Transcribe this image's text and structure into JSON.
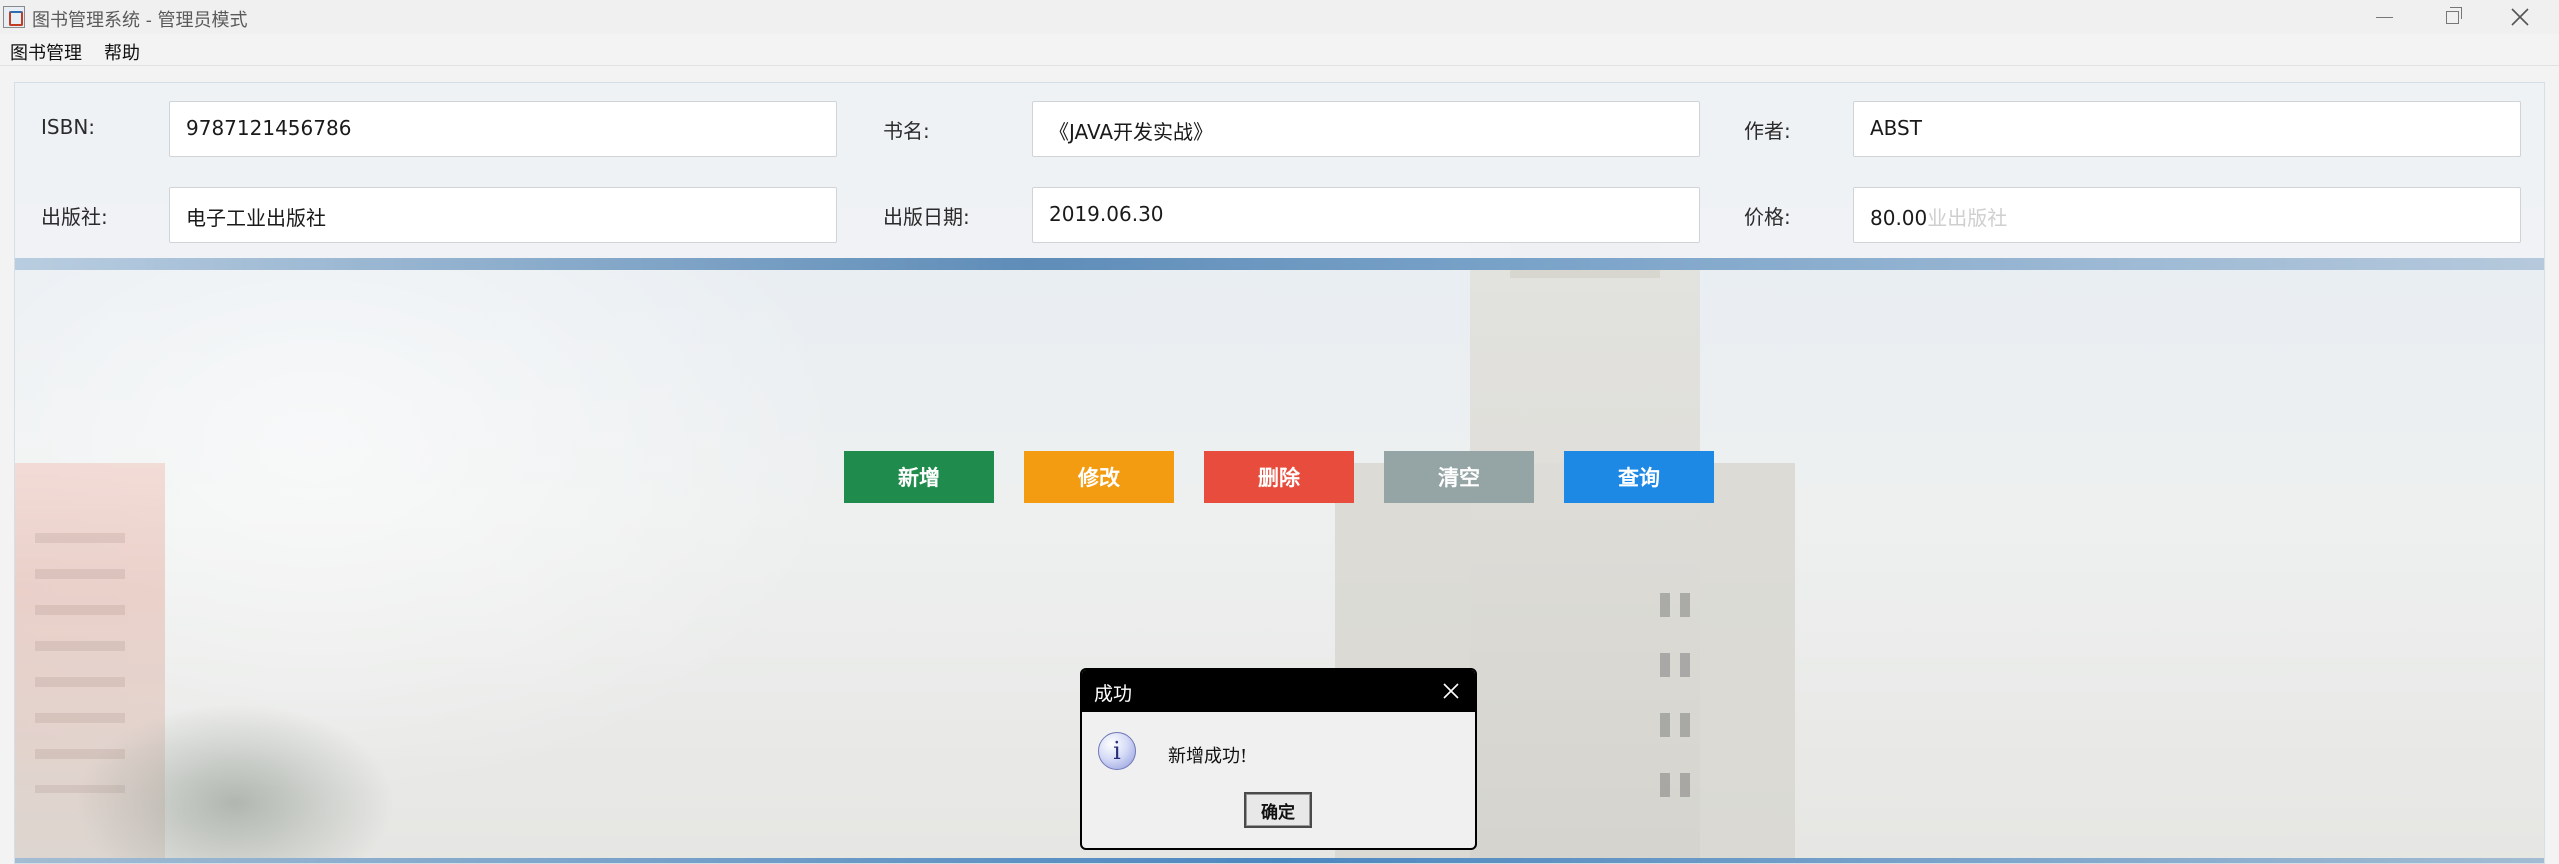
{
  "window": {
    "title": "图书管理系统 - 管理员模式"
  },
  "menu": {
    "items": [
      "图书管理",
      "帮助"
    ]
  },
  "form": {
    "isbn_label": "ISBN:",
    "isbn_value": "9787121456786",
    "title_label": "书名:",
    "title_value": "《JAVA开发实战》",
    "author_label": "作者:",
    "author_value": "ABST",
    "publisher_label": "出版社:",
    "publisher_value": "电子工业出版社",
    "pubdate_label": "出版日期:",
    "pubdate_value": "2019.06.30",
    "price_label": "价格:",
    "price_value": "80.00",
    "price_ghost_text": "业出版社"
  },
  "actions": {
    "add_label": "新增",
    "edit_label": "修改",
    "delete_label": "删除",
    "clear_label": "清空",
    "query_label": "查询"
  },
  "colors": {
    "add": "#1f8c4d",
    "edit": "#f39c12",
    "delete": "#e74c3c",
    "clear": "#95a5a6",
    "query": "#1e88e5"
  },
  "dialog": {
    "title": "成功",
    "message": "新增成功!",
    "ok_label": "确定",
    "icon": "info-icon"
  }
}
